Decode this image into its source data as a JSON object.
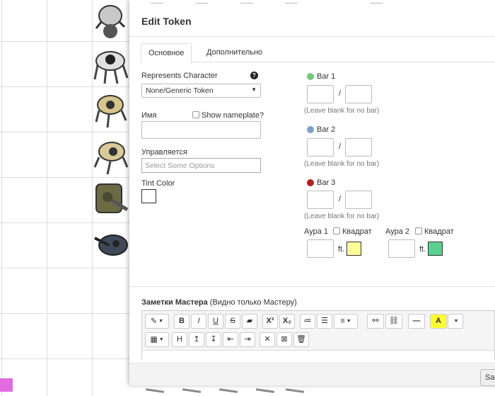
{
  "dialog": {
    "title": "Edit Token",
    "tabs": [
      "Основное",
      "Дополнительно"
    ],
    "represents_label": "Represents Character",
    "represents_value": "None/Generic Token",
    "help_glyph": "?",
    "name_label": "Имя",
    "show_nameplate_label": "Show nameplate?",
    "controlled_label": "Управляется",
    "controlled_placeholder": "Select Some Options",
    "tint_label": "Tint Color",
    "bars": [
      {
        "label": "Bar 1",
        "color": "#79c77a",
        "hint": "(Leave blank for no bar)"
      },
      {
        "label": "Bar 2",
        "color": "#7f9fc9",
        "hint": "(Leave blank for no bar)"
      },
      {
        "label": "Bar 3",
        "color": "#b21f1f",
        "hint": "(Leave blank for no bar)"
      }
    ],
    "slash": "/",
    "auras": [
      {
        "label": "Аура 1",
        "square_label": "Квадрат",
        "unit": "ft.",
        "color": "#fefe99"
      },
      {
        "label": "Аура 2",
        "square_label": "Квадрат",
        "unit": "ft.",
        "color": "#59d08f"
      }
    ],
    "notes_title": "Заметки Мастера",
    "notes_subtitle": " (Видно только Мастеру)",
    "save_label": "Sa"
  },
  "toolbar": {
    "row1": [
      "✎",
      "B",
      "I",
      "U",
      "S",
      "▰",
      "X²",
      "X₂",
      "≔",
      "☰",
      "≡",
      "⚯",
      "⛓",
      "—",
      "A",
      ""
    ],
    "row2": [
      "▦",
      "H",
      "↥",
      "↧",
      "⇤",
      "⇥",
      "✕",
      "⊠",
      "🗑"
    ]
  }
}
